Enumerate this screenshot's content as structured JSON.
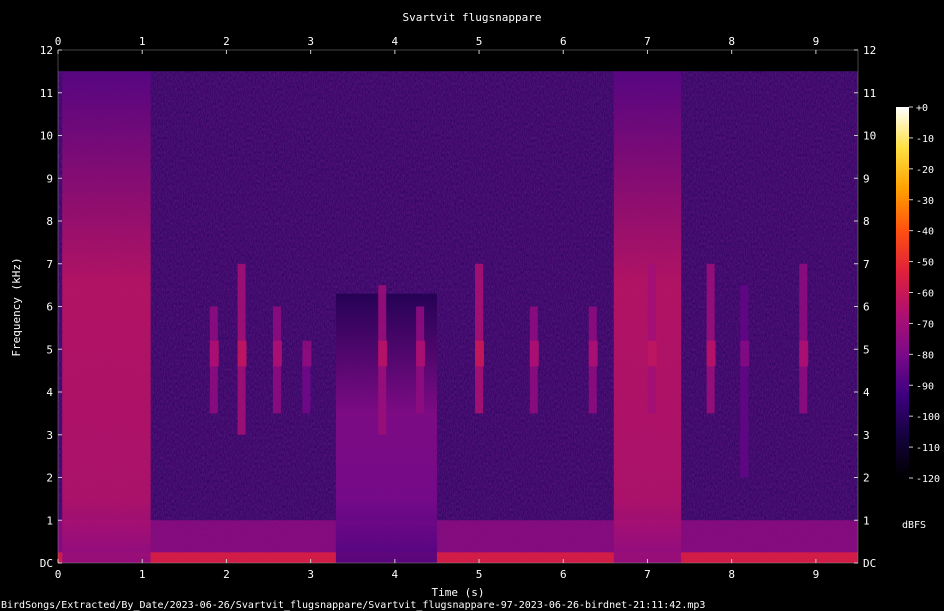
{
  "chart_data": {
    "type": "heatmap",
    "title": "Svartvit flugsnappare",
    "xlabel": "Time (s)",
    "ylabel": "Frequency (kHz)",
    "xlim": [
      0,
      9.5
    ],
    "ylim": [
      0,
      12
    ],
    "x_ticks": [
      "0",
      "1",
      "2",
      "3",
      "4",
      "5",
      "6",
      "7",
      "8",
      "9"
    ],
    "y_ticks": [
      "DC",
      "1",
      "2",
      "3",
      "4",
      "5",
      "6",
      "7",
      "8",
      "9",
      "10",
      "11",
      "12"
    ],
    "colorbar": {
      "label": "dBFS",
      "range": [
        -120,
        0
      ],
      "ticks": [
        "+0",
        "-10",
        "-20",
        "-30",
        "-40",
        "-50",
        "-60",
        "-70",
        "-80",
        "-90",
        "-100",
        "-110",
        "-120"
      ],
      "colors": [
        "#000000",
        "#14023c",
        "#3c007e",
        "#7a0a8a",
        "#b01070",
        "#e0203c",
        "#ff5010",
        "#ffa000",
        "#ffe040",
        "#ffffff"
      ]
    },
    "segments_broadband": [
      {
        "t_start": 0.05,
        "t_end": 1.1,
        "f_max": 11.5,
        "level_db": -65,
        "peak_band_khz": [
          1.5,
          6.5
        ]
      },
      {
        "t_start": 3.3,
        "t_end": 4.5,
        "f_max": 6.3,
        "level_db": -80,
        "peak_band_khz": [
          1.5,
          3.5
        ]
      },
      {
        "t_start": 6.6,
        "t_end": 7.4,
        "f_max": 11.5,
        "level_db": -65,
        "peak_band_khz": [
          1.5,
          6.5
        ]
      }
    ],
    "bird_calls": [
      {
        "t": 1.85,
        "f_low": 3.5,
        "f_high": 6.0,
        "level_db": -75
      },
      {
        "t": 2.18,
        "f_low": 3.0,
        "f_high": 7.0,
        "level_db": -70
      },
      {
        "t": 2.6,
        "f_low": 3.5,
        "f_high": 6.0,
        "level_db": -75
      },
      {
        "t": 2.95,
        "f_low": 3.5,
        "f_high": 5.0,
        "level_db": -82
      },
      {
        "t": 3.85,
        "f_low": 3.0,
        "f_high": 6.5,
        "level_db": -72
      },
      {
        "t": 4.3,
        "f_low": 3.5,
        "f_high": 6.0,
        "level_db": -75
      },
      {
        "t": 5.0,
        "f_low": 3.5,
        "f_high": 7.0,
        "level_db": -68
      },
      {
        "t": 5.65,
        "f_low": 3.5,
        "f_high": 6.0,
        "level_db": -75
      },
      {
        "t": 6.35,
        "f_low": 3.5,
        "f_high": 6.0,
        "level_db": -75
      },
      {
        "t": 7.05,
        "f_low": 3.5,
        "f_high": 7.0,
        "level_db": -70
      },
      {
        "t": 7.75,
        "f_low": 3.5,
        "f_high": 7.0,
        "level_db": -72
      },
      {
        "t": 8.15,
        "f_low": 2.0,
        "f_high": 6.5,
        "level_db": -85
      },
      {
        "t": 8.85,
        "f_low": 3.5,
        "f_high": 7.0,
        "level_db": -75
      }
    ],
    "noise_floor_db": -100,
    "low_freq_band_db": -75
  },
  "footer_path": "BirdSongs/Extracted/By_Date/2023-06-26/Svartvit_flugsnappare/Svartvit_flugsnappare-97-2023-06-26-birdnet-21:11:42.mp3"
}
